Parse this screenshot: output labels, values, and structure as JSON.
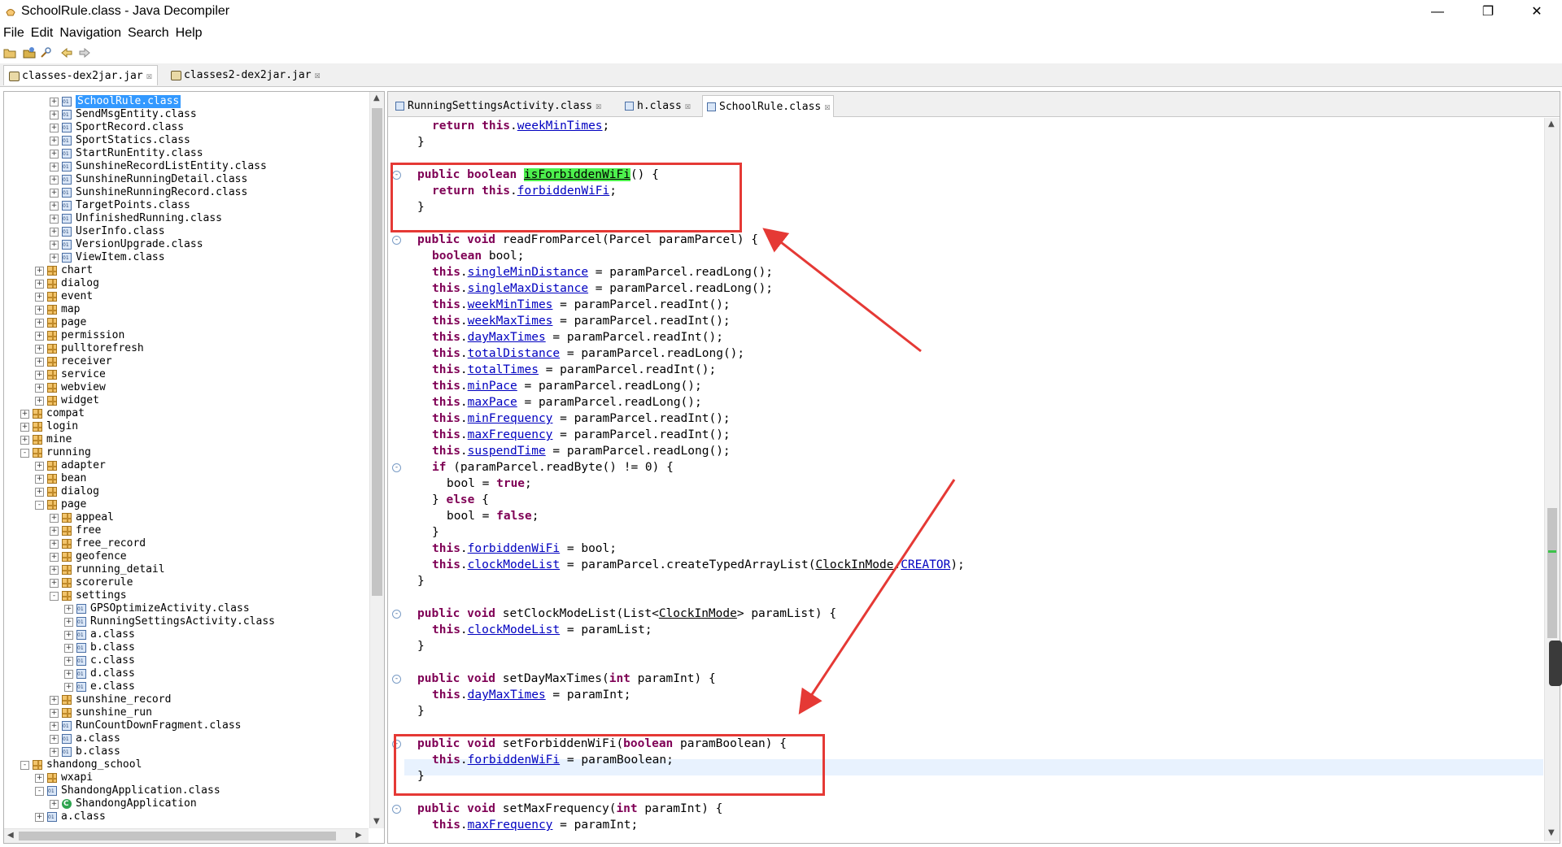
{
  "window": {
    "title": "SchoolRule.class - Java Decompiler",
    "minimize": "—",
    "maximize": "❐",
    "close": "✕"
  },
  "menu": {
    "items": [
      "File",
      "Edit",
      "Navigation",
      "Search",
      "Help"
    ]
  },
  "jar_tabs": [
    {
      "label": "classes-dex2jar.jar",
      "close": "☒",
      "active": true
    },
    {
      "label": "classes2-dex2jar.jar",
      "close": "☒",
      "active": false
    }
  ],
  "editor_tabs": [
    {
      "label": "RunningSettingsActivity.class",
      "close": "☒",
      "active": false
    },
    {
      "label": "h.class",
      "close": "☒",
      "active": false
    },
    {
      "label": "SchoolRule.class",
      "close": "☒",
      "active": true
    }
  ],
  "tree": [
    {
      "label": "SchoolRule.class",
      "indent": 4,
      "icon": "class",
      "expander": "+",
      "selected": true
    },
    {
      "label": "SendMsgEntity.class",
      "indent": 4,
      "icon": "class",
      "expander": "+"
    },
    {
      "label": "SportRecord.class",
      "indent": 4,
      "icon": "class",
      "expander": "+"
    },
    {
      "label": "SportStatics.class",
      "indent": 4,
      "icon": "class",
      "expander": "+"
    },
    {
      "label": "StartRunEntity.class",
      "indent": 4,
      "icon": "class",
      "expander": "+"
    },
    {
      "label": "SunshineRecordListEntity.class",
      "indent": 4,
      "icon": "class",
      "expander": "+"
    },
    {
      "label": "SunshineRunningDetail.class",
      "indent": 4,
      "icon": "class",
      "expander": "+"
    },
    {
      "label": "SunshineRunningRecord.class",
      "indent": 4,
      "icon": "class",
      "expander": "+"
    },
    {
      "label": "TargetPoints.class",
      "indent": 4,
      "icon": "class",
      "expander": "+"
    },
    {
      "label": "UnfinishedRunning.class",
      "indent": 4,
      "icon": "class",
      "expander": "+"
    },
    {
      "label": "UserInfo.class",
      "indent": 4,
      "icon": "class",
      "expander": "+"
    },
    {
      "label": "VersionUpgrade.class",
      "indent": 4,
      "icon": "class",
      "expander": "+"
    },
    {
      "label": "ViewItem.class",
      "indent": 4,
      "icon": "class",
      "expander": "+"
    },
    {
      "label": "chart",
      "indent": 3,
      "icon": "package",
      "expander": "+"
    },
    {
      "label": "dialog",
      "indent": 3,
      "icon": "package",
      "expander": "+"
    },
    {
      "label": "event",
      "indent": 3,
      "icon": "package",
      "expander": "+"
    },
    {
      "label": "map",
      "indent": 3,
      "icon": "package",
      "expander": "+"
    },
    {
      "label": "page",
      "indent": 3,
      "icon": "package",
      "expander": "+"
    },
    {
      "label": "permission",
      "indent": 3,
      "icon": "package",
      "expander": "+"
    },
    {
      "label": "pulltorefresh",
      "indent": 3,
      "icon": "package",
      "expander": "+"
    },
    {
      "label": "receiver",
      "indent": 3,
      "icon": "package",
      "expander": "+"
    },
    {
      "label": "service",
      "indent": 3,
      "icon": "package",
      "expander": "+"
    },
    {
      "label": "webview",
      "indent": 3,
      "icon": "package",
      "expander": "+"
    },
    {
      "label": "widget",
      "indent": 3,
      "icon": "package",
      "expander": "+"
    },
    {
      "label": "compat",
      "indent": 2,
      "icon": "package",
      "expander": "+"
    },
    {
      "label": "login",
      "indent": 2,
      "icon": "package",
      "expander": "+"
    },
    {
      "label": "mine",
      "indent": 2,
      "icon": "package",
      "expander": "+"
    },
    {
      "label": "running",
      "indent": 2,
      "icon": "package",
      "expander": "-"
    },
    {
      "label": "adapter",
      "indent": 3,
      "icon": "package",
      "expander": "+"
    },
    {
      "label": "bean",
      "indent": 3,
      "icon": "package",
      "expander": "+"
    },
    {
      "label": "dialog",
      "indent": 3,
      "icon": "package",
      "expander": "+"
    },
    {
      "label": "page",
      "indent": 3,
      "icon": "package",
      "expander": "-"
    },
    {
      "label": "appeal",
      "indent": 4,
      "icon": "package",
      "expander": "+"
    },
    {
      "label": "free",
      "indent": 4,
      "icon": "package",
      "expander": "+"
    },
    {
      "label": "free_record",
      "indent": 4,
      "icon": "package",
      "expander": "+"
    },
    {
      "label": "geofence",
      "indent": 4,
      "icon": "package",
      "expander": "+"
    },
    {
      "label": "running_detail",
      "indent": 4,
      "icon": "package",
      "expander": "+"
    },
    {
      "label": "scorerule",
      "indent": 4,
      "icon": "package",
      "expander": "+"
    },
    {
      "label": "settings",
      "indent": 4,
      "icon": "package",
      "expander": "-"
    },
    {
      "label": "GPSOptimizeActivity.class",
      "indent": 5,
      "icon": "class",
      "expander": "+"
    },
    {
      "label": "RunningSettingsActivity.class",
      "indent": 5,
      "icon": "class",
      "expander": "+"
    },
    {
      "label": "a.class",
      "indent": 5,
      "icon": "class",
      "expander": "+"
    },
    {
      "label": "b.class",
      "indent": 5,
      "icon": "class",
      "expander": "+"
    },
    {
      "label": "c.class",
      "indent": 5,
      "icon": "class",
      "expander": "+"
    },
    {
      "label": "d.class",
      "indent": 5,
      "icon": "class",
      "expander": "+"
    },
    {
      "label": "e.class",
      "indent": 5,
      "icon": "class",
      "expander": "+"
    },
    {
      "label": "sunshine_record",
      "indent": 4,
      "icon": "package",
      "expander": "+"
    },
    {
      "label": "sunshine_run",
      "indent": 4,
      "icon": "package",
      "expander": "+"
    },
    {
      "label": "RunCountDownFragment.class",
      "indent": 4,
      "icon": "class",
      "expander": "+"
    },
    {
      "label": "a.class",
      "indent": 4,
      "icon": "class",
      "expander": "+"
    },
    {
      "label": "b.class",
      "indent": 4,
      "icon": "class",
      "expander": "+"
    },
    {
      "label": "shandong_school",
      "indent": 2,
      "icon": "package",
      "expander": "-"
    },
    {
      "label": "wxapi",
      "indent": 3,
      "icon": "package",
      "expander": "+"
    },
    {
      "label": "ShandongApplication.class",
      "indent": 3,
      "icon": "class",
      "expander": "-"
    },
    {
      "label": "ShandongApplication",
      "indent": 4,
      "icon": "green",
      "expander": "+"
    },
    {
      "label": "a.class",
      "indent": 3,
      "icon": "class",
      "expander": "+"
    }
  ],
  "code": [
    {
      "fold": "",
      "tokens": [
        [
          "k",
          "return "
        ],
        [
          "k",
          "this"
        ],
        [
          "t",
          "."
        ],
        [
          "f",
          "weekMinTimes"
        ],
        [
          "t",
          ";"
        ]
      ],
      "indent": 2
    },
    {
      "fold": "",
      "tokens": [
        [
          "t",
          "}"
        ]
      ],
      "indent": 1
    },
    {
      "fold": "",
      "tokens": [],
      "indent": 0
    },
    {
      "fold": "-",
      "tokens": [
        [
          "k",
          "public "
        ],
        [
          "k",
          "boolean "
        ],
        [
          "h",
          "isForbiddenWiFi"
        ],
        [
          "t",
          "() {"
        ]
      ],
      "indent": 1
    },
    {
      "fold": "",
      "tokens": [
        [
          "k",
          "return "
        ],
        [
          "k",
          "this"
        ],
        [
          "t",
          "."
        ],
        [
          "f",
          "forbiddenWiFi"
        ],
        [
          "t",
          ";"
        ]
      ],
      "indent": 2
    },
    {
      "fold": "",
      "tokens": [
        [
          "t",
          "}"
        ]
      ],
      "indent": 1
    },
    {
      "fold": "",
      "tokens": [],
      "indent": 0
    },
    {
      "fold": "-",
      "tokens": [
        [
          "k",
          "public "
        ],
        [
          "k",
          "void "
        ],
        [
          "t",
          "readFromParcel(Parcel paramParcel) {"
        ]
      ],
      "indent": 1
    },
    {
      "fold": "",
      "tokens": [
        [
          "k",
          "boolean "
        ],
        [
          "t",
          "bool;"
        ]
      ],
      "indent": 2
    },
    {
      "fold": "",
      "tokens": [
        [
          "k",
          "this"
        ],
        [
          "t",
          "."
        ],
        [
          "f",
          "singleMinDistance"
        ],
        [
          "t",
          " = paramParcel.readLong();"
        ]
      ],
      "indent": 2
    },
    {
      "fold": "",
      "tokens": [
        [
          "k",
          "this"
        ],
        [
          "t",
          "."
        ],
        [
          "f",
          "singleMaxDistance"
        ],
        [
          "t",
          " = paramParcel.readLong();"
        ]
      ],
      "indent": 2
    },
    {
      "fold": "",
      "tokens": [
        [
          "k",
          "this"
        ],
        [
          "t",
          "."
        ],
        [
          "f",
          "weekMinTimes"
        ],
        [
          "t",
          " = paramParcel.readInt();"
        ]
      ],
      "indent": 2
    },
    {
      "fold": "",
      "tokens": [
        [
          "k",
          "this"
        ],
        [
          "t",
          "."
        ],
        [
          "f",
          "weekMaxTimes"
        ],
        [
          "t",
          " = paramParcel.readInt();"
        ]
      ],
      "indent": 2
    },
    {
      "fold": "",
      "tokens": [
        [
          "k",
          "this"
        ],
        [
          "t",
          "."
        ],
        [
          "f",
          "dayMaxTimes"
        ],
        [
          "t",
          " = paramParcel.readInt();"
        ]
      ],
      "indent": 2
    },
    {
      "fold": "",
      "tokens": [
        [
          "k",
          "this"
        ],
        [
          "t",
          "."
        ],
        [
          "f",
          "totalDistance"
        ],
        [
          "t",
          " = paramParcel.readLong();"
        ]
      ],
      "indent": 2
    },
    {
      "fold": "",
      "tokens": [
        [
          "k",
          "this"
        ],
        [
          "t",
          "."
        ],
        [
          "f",
          "totalTimes"
        ],
        [
          "t",
          " = paramParcel.readInt();"
        ]
      ],
      "indent": 2
    },
    {
      "fold": "",
      "tokens": [
        [
          "k",
          "this"
        ],
        [
          "t",
          "."
        ],
        [
          "f",
          "minPace"
        ],
        [
          "t",
          " = paramParcel.readLong();"
        ]
      ],
      "indent": 2
    },
    {
      "fold": "",
      "tokens": [
        [
          "k",
          "this"
        ],
        [
          "t",
          "."
        ],
        [
          "f",
          "maxPace"
        ],
        [
          "t",
          " = paramParcel.readLong();"
        ]
      ],
      "indent": 2
    },
    {
      "fold": "",
      "tokens": [
        [
          "k",
          "this"
        ],
        [
          "t",
          "."
        ],
        [
          "f",
          "minFrequency"
        ],
        [
          "t",
          " = paramParcel.readInt();"
        ]
      ],
      "indent": 2
    },
    {
      "fold": "",
      "tokens": [
        [
          "k",
          "this"
        ],
        [
          "t",
          "."
        ],
        [
          "f",
          "maxFrequency"
        ],
        [
          "t",
          " = paramParcel.readInt();"
        ]
      ],
      "indent": 2
    },
    {
      "fold": "",
      "tokens": [
        [
          "k",
          "this"
        ],
        [
          "t",
          "."
        ],
        [
          "f",
          "suspendTime"
        ],
        [
          "t",
          " = paramParcel.readLong();"
        ]
      ],
      "indent": 2
    },
    {
      "fold": "-",
      "tokens": [
        [
          "k",
          "if "
        ],
        [
          "t",
          "(paramParcel.readByte() != 0) {"
        ]
      ],
      "indent": 2
    },
    {
      "fold": "",
      "tokens": [
        [
          "t",
          "bool = "
        ],
        [
          "k",
          "true"
        ],
        [
          "t",
          ";"
        ]
      ],
      "indent": 3
    },
    {
      "fold": "",
      "tokens": [
        [
          "t",
          "} "
        ],
        [
          "k",
          "else "
        ],
        [
          "t",
          "{"
        ]
      ],
      "indent": 2
    },
    {
      "fold": "",
      "tokens": [
        [
          "t",
          "bool = "
        ],
        [
          "k",
          "false"
        ],
        [
          "t",
          ";"
        ]
      ],
      "indent": 3
    },
    {
      "fold": "",
      "tokens": [
        [
          "t",
          "}"
        ]
      ],
      "indent": 2
    },
    {
      "fold": "",
      "tokens": [
        [
          "k",
          "this"
        ],
        [
          "t",
          "."
        ],
        [
          "f",
          "forbiddenWiFi"
        ],
        [
          "t",
          " = bool;"
        ]
      ],
      "indent": 2
    },
    {
      "fold": "",
      "tokens": [
        [
          "k",
          "this"
        ],
        [
          "t",
          "."
        ],
        [
          "f",
          "clockModeList"
        ],
        [
          "t",
          " = paramParcel.createTypedArrayList("
        ],
        [
          "u",
          "ClockInMode"
        ],
        [
          "t",
          "."
        ],
        [
          "f",
          "CREATOR"
        ],
        [
          "t",
          ");"
        ]
      ],
      "indent": 2
    },
    {
      "fold": "",
      "tokens": [
        [
          "t",
          "}"
        ]
      ],
      "indent": 1
    },
    {
      "fold": "",
      "tokens": [],
      "indent": 0
    },
    {
      "fold": "-",
      "tokens": [
        [
          "k",
          "public "
        ],
        [
          "k",
          "void "
        ],
        [
          "t",
          "setClockModeList(List<"
        ],
        [
          "u",
          "ClockInMode"
        ],
        [
          "t",
          "> paramList) {"
        ]
      ],
      "indent": 1
    },
    {
      "fold": "",
      "tokens": [
        [
          "k",
          "this"
        ],
        [
          "t",
          "."
        ],
        [
          "f",
          "clockModeList"
        ],
        [
          "t",
          " = paramList;"
        ]
      ],
      "indent": 2
    },
    {
      "fold": "",
      "tokens": [
        [
          "t",
          "}"
        ]
      ],
      "indent": 1
    },
    {
      "fold": "",
      "tokens": [],
      "indent": 0
    },
    {
      "fold": "-",
      "tokens": [
        [
          "k",
          "public "
        ],
        [
          "k",
          "void "
        ],
        [
          "t",
          "setDayMaxTimes("
        ],
        [
          "k",
          "int "
        ],
        [
          "t",
          "paramInt) {"
        ]
      ],
      "indent": 1
    },
    {
      "fold": "",
      "tokens": [
        [
          "k",
          "this"
        ],
        [
          "t",
          "."
        ],
        [
          "f",
          "dayMaxTimes"
        ],
        [
          "t",
          " = paramInt;"
        ]
      ],
      "indent": 2
    },
    {
      "fold": "",
      "tokens": [
        [
          "t",
          "}"
        ]
      ],
      "indent": 1
    },
    {
      "fold": "",
      "tokens": [],
      "indent": 0
    },
    {
      "fold": "-",
      "tokens": [
        [
          "k",
          "public "
        ],
        [
          "k",
          "void "
        ],
        [
          "t",
          "setForbiddenWiFi("
        ],
        [
          "k",
          "boolean "
        ],
        [
          "t",
          "paramBoolean) {"
        ]
      ],
      "indent": 1
    },
    {
      "fold": "",
      "tokens": [
        [
          "k",
          "this"
        ],
        [
          "t",
          "."
        ],
        [
          "f",
          "forbiddenWiFi"
        ],
        [
          "t",
          " = paramBoolean;"
        ]
      ],
      "indent": 2
    },
    {
      "fold": "",
      "tokens": [
        [
          "t",
          "}"
        ]
      ],
      "indent": 1
    },
    {
      "fold": "",
      "tokens": [],
      "indent": 0
    },
    {
      "fold": "-",
      "tokens": [
        [
          "k",
          "public "
        ],
        [
          "k",
          "void "
        ],
        [
          "t",
          "setMaxFrequency("
        ],
        [
          "k",
          "int "
        ],
        [
          "t",
          "paramInt) {"
        ]
      ],
      "indent": 1
    },
    {
      "fold": "",
      "tokens": [
        [
          "k",
          "this"
        ],
        [
          "t",
          "."
        ],
        [
          "f",
          "maxFrequency"
        ],
        [
          "t",
          " = paramInt;"
        ]
      ],
      "indent": 2
    }
  ],
  "colors": {
    "keyword": "#7f0055",
    "field": "#0000c0",
    "highlight": "#4df04d",
    "annotation": "#e53935",
    "selection": "#3399ff"
  }
}
